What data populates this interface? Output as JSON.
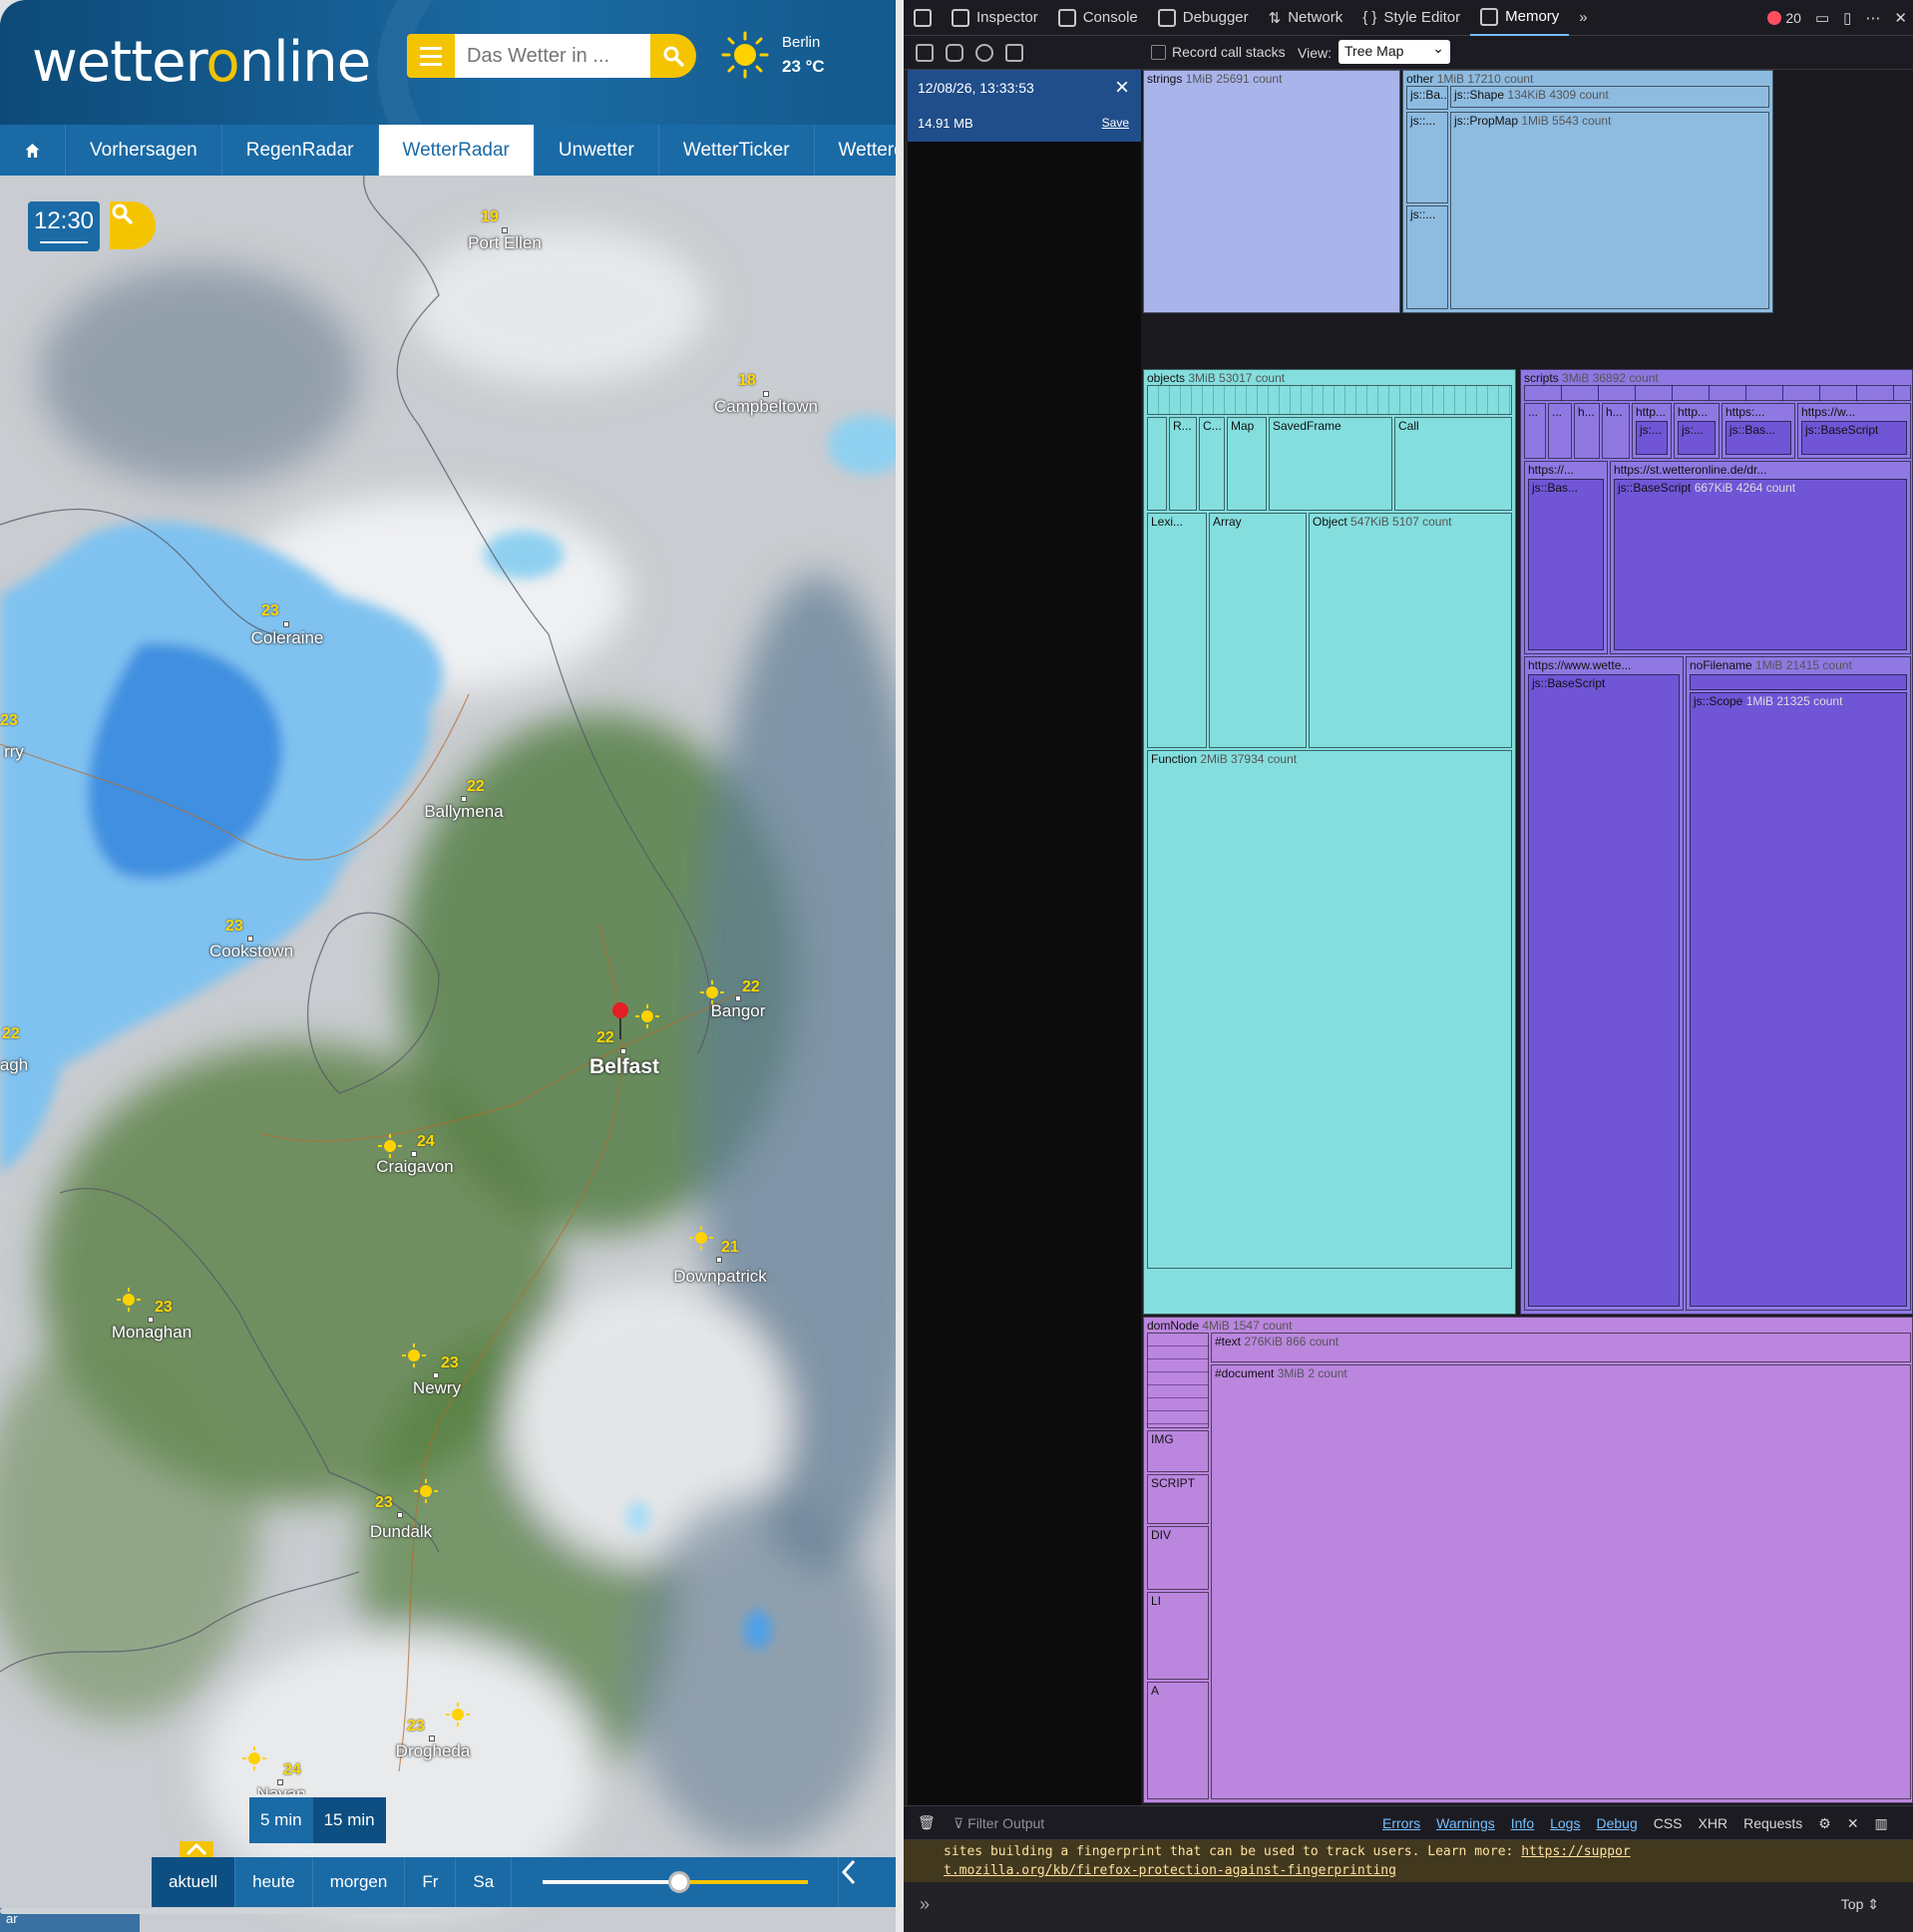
{
  "site": {
    "logo_pre": "wetter",
    "logo_o": "o",
    "logo_post": "nline",
    "search_placeholder": "Das Wetter in ...",
    "current_weather": {
      "city": "Berlin",
      "temp": "23 °C",
      "icon": "sun-icon"
    },
    "nav": [
      {
        "label": ""
      },
      {
        "label": "Vorhersagen"
      },
      {
        "label": "RegenRadar"
      },
      {
        "label": "WetterRadar",
        "active": true
      },
      {
        "label": "Unwetter"
      },
      {
        "label": "WetterTicker"
      },
      {
        "label": "Wetterdaten"
      }
    ],
    "map": {
      "time": "12:30",
      "cities": [
        {
          "name": "Port Ellen",
          "temp": "19"
        },
        {
          "name": "Campbeltown",
          "temp": "18"
        },
        {
          "name": "Coleraine",
          "temp": "23"
        },
        {
          "name": "Ballymena",
          "temp": "22"
        },
        {
          "name": "Cookstown",
          "temp": "23"
        },
        {
          "name": "Bangor",
          "temp": "22"
        },
        {
          "name": "Belfast",
          "temp": "22"
        },
        {
          "name": "Craigavon",
          "temp": "24"
        },
        {
          "name": "Downpatrick",
          "temp": "21"
        },
        {
          "name": "Monaghan",
          "temp": "23"
        },
        {
          "name": "Newry",
          "temp": "23"
        },
        {
          "name": "Dundalk",
          "temp": "23"
        },
        {
          "name": "Drogheda",
          "temp": "23"
        },
        {
          "name": "Navan",
          "temp": "24"
        },
        {
          "name": "rry",
          "temp": "23"
        },
        {
          "name": "agh",
          "temp": "22"
        }
      ],
      "interval_options": [
        "5 min",
        "15 min"
      ],
      "interval_selected": "15 min",
      "time_tabs": [
        "aktuell",
        "heute",
        "morgen",
        "Fr",
        "Sa"
      ],
      "time_selected": "aktuell",
      "slider_position": 0.5,
      "attribution": "ar"
    }
  },
  "devtools": {
    "tabs": [
      "Inspector",
      "Console",
      "Debugger",
      "Network",
      "Style Editor",
      "Memory"
    ],
    "selected_tab": "Memory",
    "error_count": "20",
    "record_call_stacks": "Record call stacks",
    "view_label": "View:",
    "view_value": "Tree Map",
    "snapshot": {
      "date": "12/08/26, 13:33:53",
      "size": "14.91 MB",
      "save": "Save"
    },
    "treemap": {
      "strings": {
        "label": "strings",
        "meta": "1MiB 25691 count"
      },
      "other": {
        "label": "other",
        "meta": "1MiB 17210 count",
        "children": [
          {
            "label": "js::Ba..."
          },
          {
            "label": "js::Shape",
            "meta": "134KiB 4309 count"
          },
          {
            "label": "js::..."
          },
          {
            "label": "js::PropMap",
            "meta": "1MiB 5543 count"
          },
          {
            "label": "js::..."
          }
        ]
      },
      "objects": {
        "label": "objects",
        "meta": "3MiB 53017 count",
        "children": [
          {
            "label": "R..."
          },
          {
            "label": "C..."
          },
          {
            "label": "Map"
          },
          {
            "label": "SavedFrame"
          },
          {
            "label": "Call"
          },
          {
            "label": "Lexi..."
          },
          {
            "label": "Array"
          },
          {
            "label": "Object",
            "meta": "547KiB 5107 count"
          },
          {
            "label": "Function",
            "meta": "2MiB 37934 count"
          }
        ]
      },
      "scripts": {
        "label": "scripts",
        "meta": "3MiB 36892 count",
        "children": [
          {
            "label": "..."
          },
          {
            "label": "..."
          },
          {
            "label": "h..."
          },
          {
            "label": "h..."
          },
          {
            "label": "http..."
          },
          {
            "label": "js:..."
          },
          {
            "label": "http..."
          },
          {
            "label": "js:..."
          },
          {
            "label": "https:..."
          },
          {
            "label": "js::Bas..."
          },
          {
            "label": "https://w..."
          },
          {
            "label": "js::BaseScript"
          },
          {
            "label": "https://..."
          },
          {
            "label": "js::Bas..."
          },
          {
            "label": "https://st.wetteronline.de/dr..."
          },
          {
            "label": "js::BaseScript",
            "meta": "667KiB 4264 count"
          },
          {
            "label": "https://www.wette..."
          },
          {
            "label": "js::BaseScript"
          },
          {
            "label": "noFilename",
            "meta": "1MiB 21415 count"
          },
          {
            "label": "js::Scope",
            "meta": "1MiB 21325 count"
          }
        ]
      },
      "domNode": {
        "label": "domNode",
        "meta": "4MiB 1547 count",
        "children": [
          {
            "label": "#text",
            "meta": "276KiB 866 count"
          },
          {
            "label": "#document",
            "meta": "3MiB 2 count"
          },
          {
            "label": "IMG"
          },
          {
            "label": "SCRIPT"
          },
          {
            "label": "DIV"
          },
          {
            "label": "LI"
          },
          {
            "label": "A"
          }
        ]
      }
    },
    "console": {
      "filter_placeholder": "Filter Output",
      "levels": [
        "Errors",
        "Warnings",
        "Info",
        "Logs",
        "Debug"
      ],
      "types": [
        "CSS",
        "XHR",
        "Requests"
      ],
      "message_line1": "sites building a fingerprint that can be used to track users. Learn more: ",
      "message_link1": "https://suppor",
      "message_link2": "t.mozilla.org/kb/firefox-protection-against-fingerprinting",
      "context": "Top"
    }
  }
}
